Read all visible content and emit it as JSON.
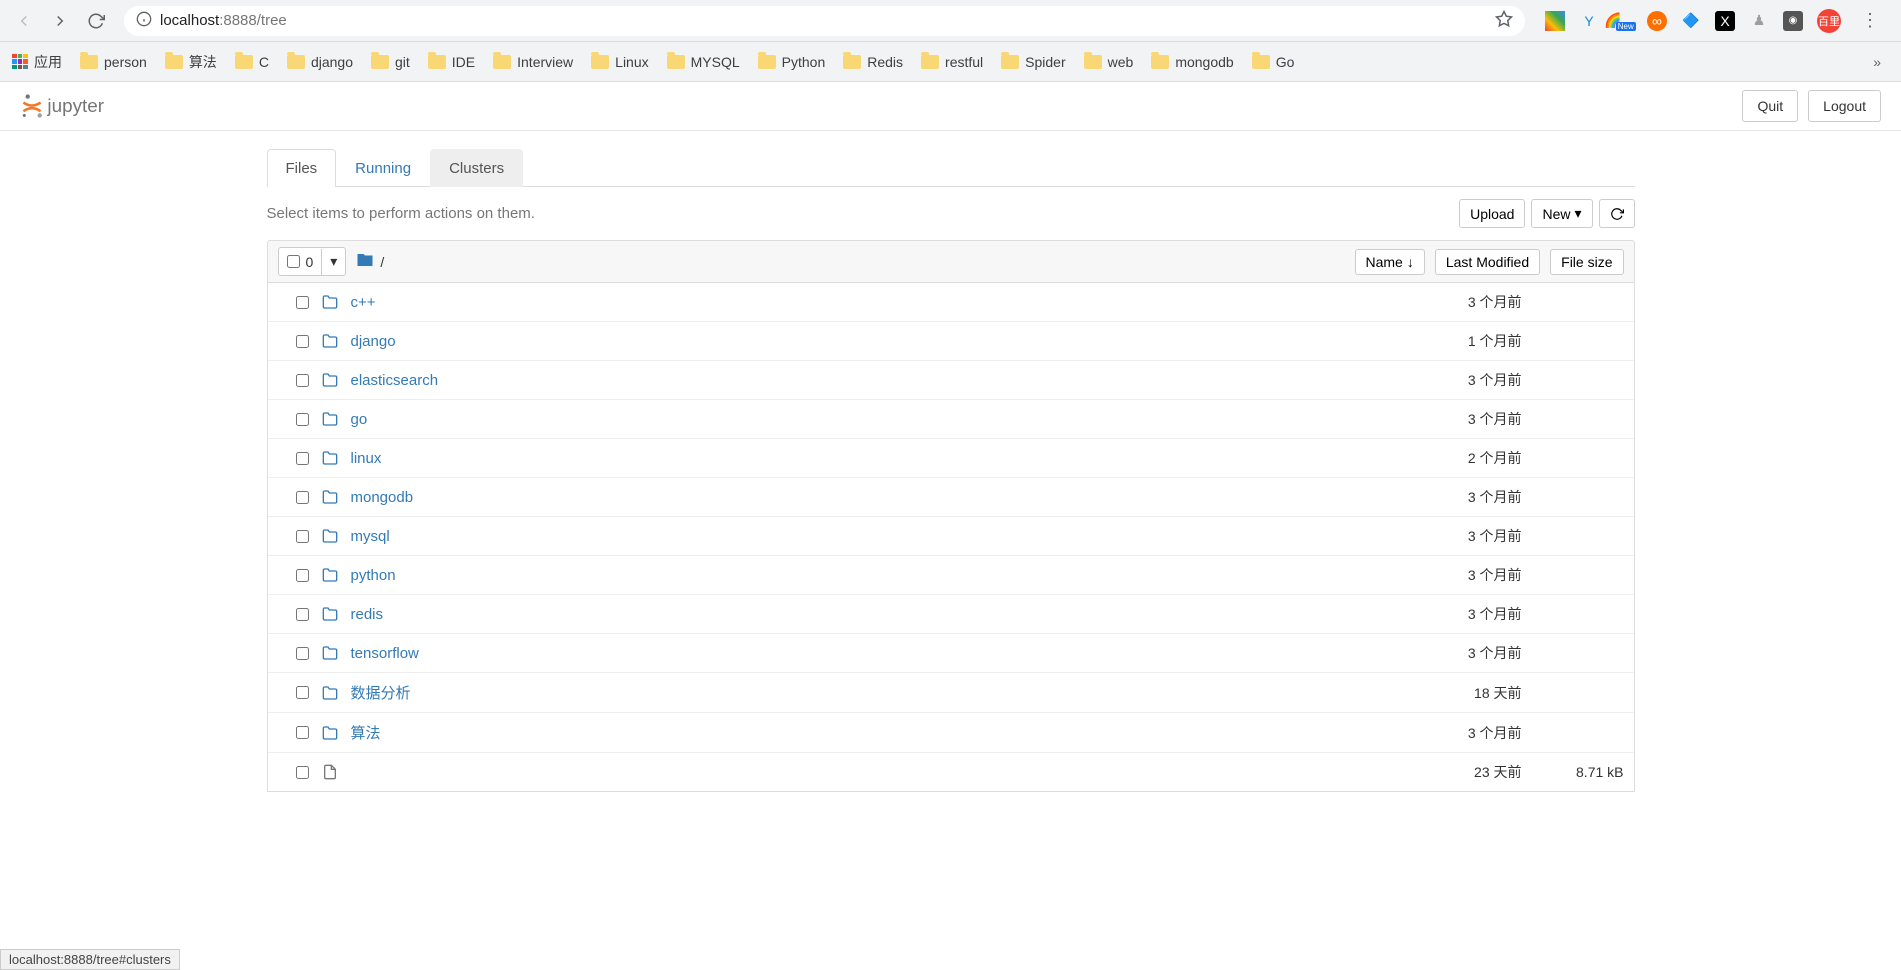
{
  "browser": {
    "url_host": "localhost",
    "url_port_path": ":8888/tree",
    "apps_label": "应用",
    "bookmarks": [
      "person",
      "算法",
      "C",
      "django",
      "git",
      "IDE",
      "Interview",
      "Linux",
      "MYSQL",
      "Python",
      "Redis",
      "restful",
      "Spider",
      "web",
      "mongodb",
      "Go"
    ],
    "avatar_text": "百里"
  },
  "header": {
    "quit_label": "Quit",
    "logout_label": "Logout"
  },
  "tabs": {
    "files": "Files",
    "running": "Running",
    "clusters": "Clusters"
  },
  "toolbar": {
    "hint": "Select items to perform actions on them.",
    "upload": "Upload",
    "new": "New",
    "refresh": "↻"
  },
  "list_header": {
    "selected_count": "0",
    "breadcrumb": "/",
    "name": "Name",
    "last_modified": "Last Modified",
    "file_size": "File size"
  },
  "files": [
    {
      "name": "c++",
      "modified": "3 个月前",
      "size": ""
    },
    {
      "name": "django",
      "modified": "1 个月前",
      "size": ""
    },
    {
      "name": "elasticsearch",
      "modified": "3 个月前",
      "size": ""
    },
    {
      "name": "go",
      "modified": "3 个月前",
      "size": ""
    },
    {
      "name": "linux",
      "modified": "2 个月前",
      "size": ""
    },
    {
      "name": "mongodb",
      "modified": "3 个月前",
      "size": ""
    },
    {
      "name": "mysql",
      "modified": "3 个月前",
      "size": ""
    },
    {
      "name": "python",
      "modified": "3 个月前",
      "size": ""
    },
    {
      "name": "redis",
      "modified": "3 个月前",
      "size": ""
    },
    {
      "name": "tensorflow",
      "modified": "3 个月前",
      "size": ""
    },
    {
      "name": "数据分析",
      "modified": "18 天前",
      "size": ""
    },
    {
      "name": "算法",
      "modified": "3 个月前",
      "size": ""
    },
    {
      "name": "",
      "modified": "23 天前",
      "size": "8.71 kB"
    }
  ],
  "status_bar": "localhost:8888/tree#clusters"
}
